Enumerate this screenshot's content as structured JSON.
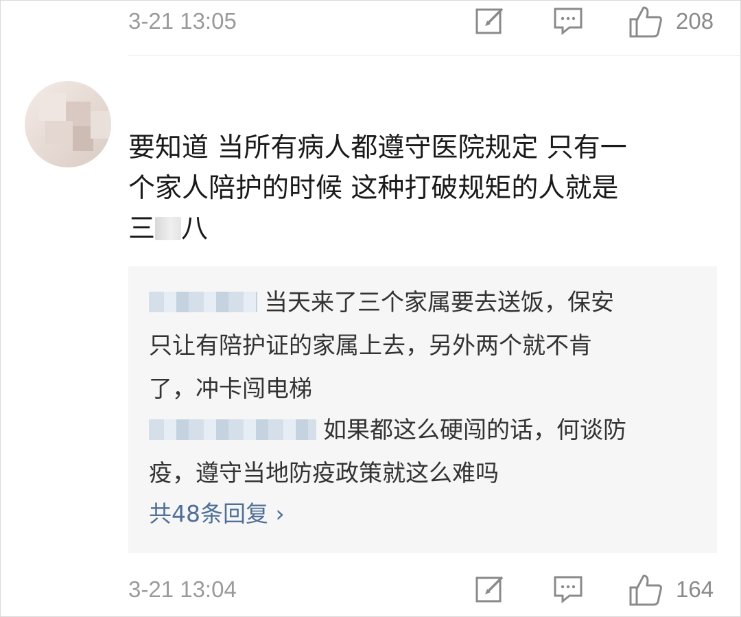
{
  "top_meta": {
    "time": "3-21 13:05",
    "likes": "208",
    "icons": [
      "edit-icon",
      "comment-icon",
      "thumbs-up-icon"
    ]
  },
  "comment": {
    "username": "",
    "text_lines": [
      "要知道 当所有病人都遵守医院规定 只有一",
      "个家人陪护的时候 这种打破规矩的人就是",
      "八"
    ],
    "prefix_visible": "三"
  },
  "replies": [
    {
      "author": "",
      "text_lines": [
        "当天来了三个家属要去送饭，保安",
        "只让有陪护证的家属上去，另外两个就不肯",
        "了，冲卡闯电梯"
      ]
    },
    {
      "author": "",
      "text_lines": [
        "如果都这么硬闯的话，何谈防",
        "疫，遵守当地防疫政策就这么难吗"
      ]
    }
  ],
  "more_replies": "共48条回复 ›",
  "bottom_meta": {
    "time": "3-21 13:04",
    "likes": "164"
  },
  "colors": {
    "meta_gray": "#9a9a9a",
    "link_blue": "#4f6f96",
    "reply_bg": "#f6f6f6"
  }
}
